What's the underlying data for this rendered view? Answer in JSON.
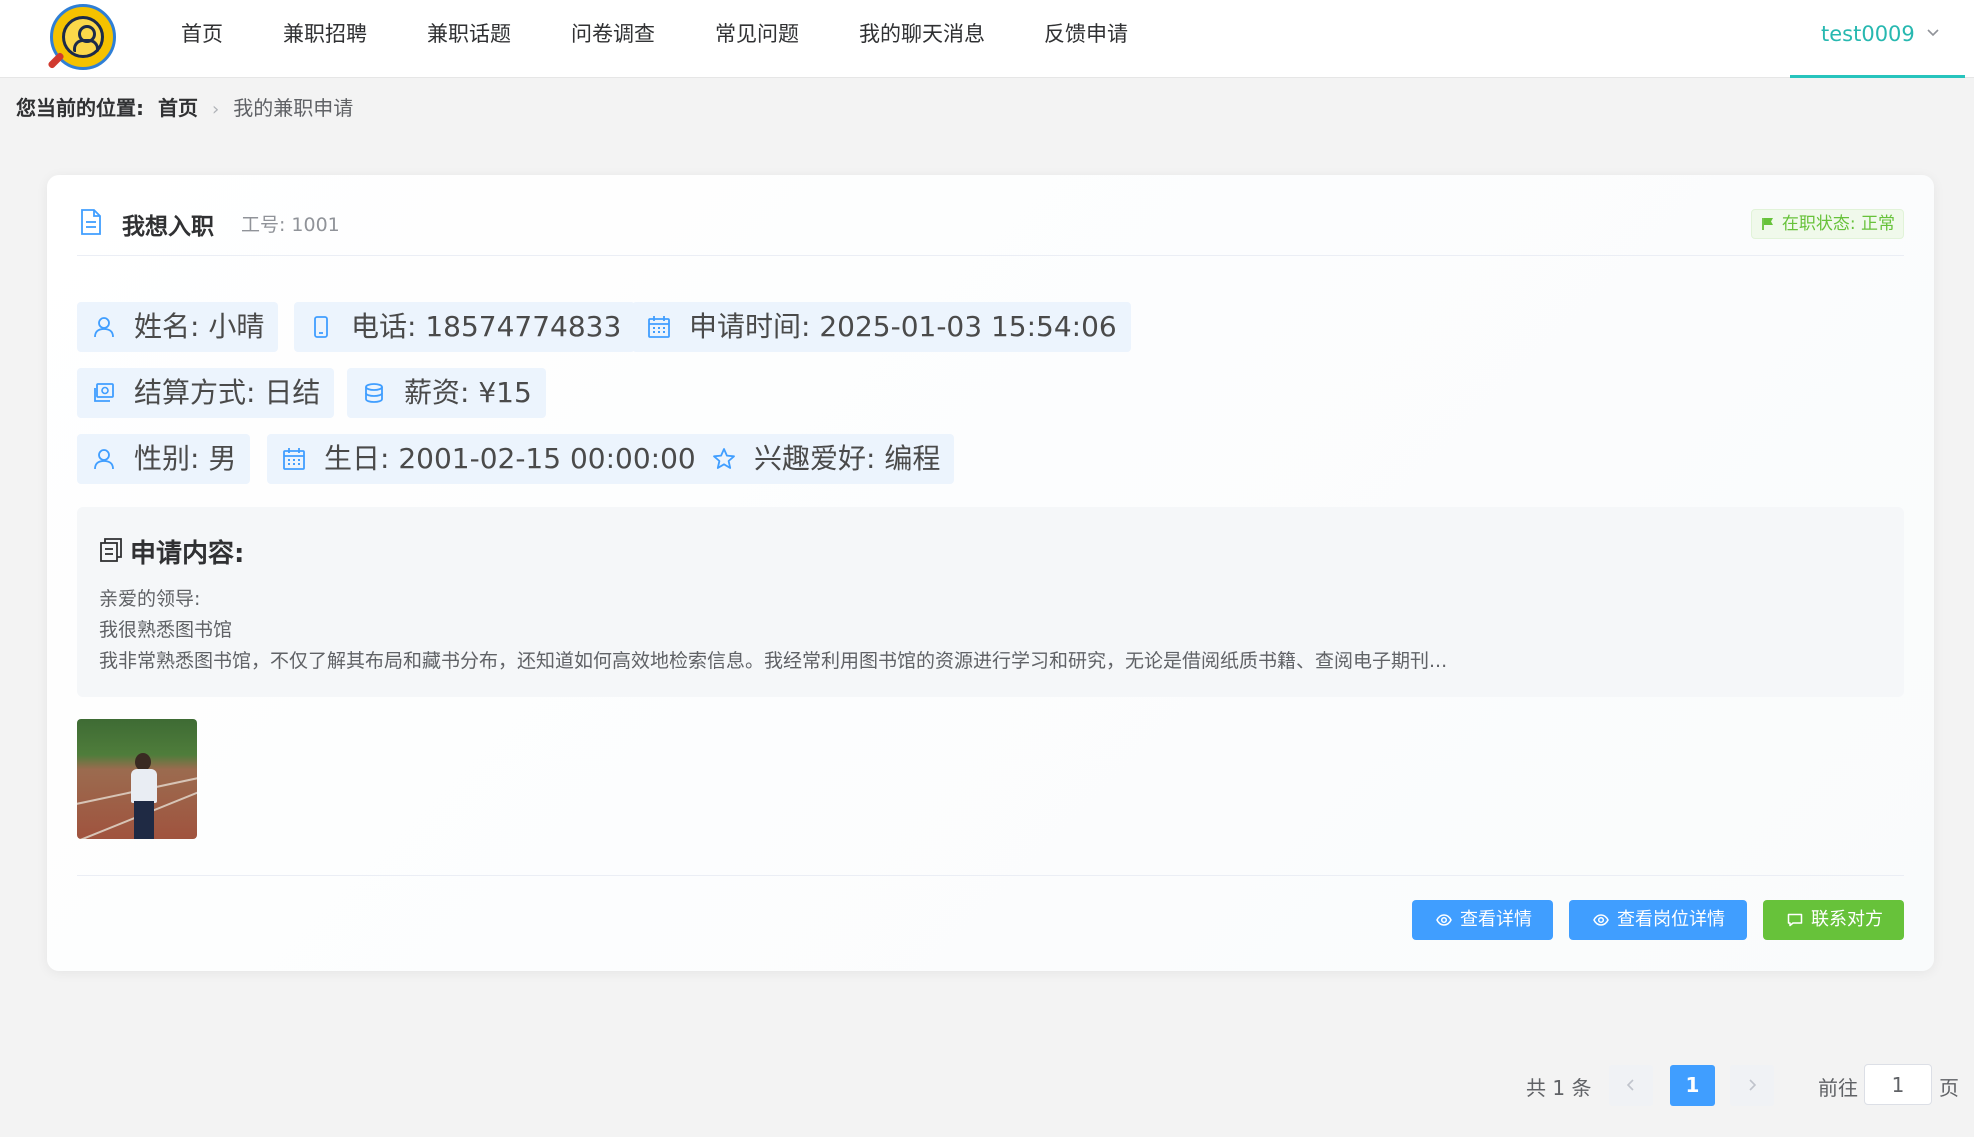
{
  "nav": {
    "items": [
      "首页",
      "兼职招聘",
      "兼职话题",
      "问卷调查",
      "常见问题",
      "我的聊天消息",
      "反馈申请"
    ],
    "user": "test0009"
  },
  "breadcrumb": {
    "label": "您当前的位置:",
    "home": "首页",
    "current": "我的兼职申请"
  },
  "card": {
    "title": "我想入职",
    "job_no_label": "工号:",
    "job_no": "1001",
    "status": "在职状态: 正常",
    "status_color": "#67c23a",
    "info": {
      "name": "姓名: 小晴",
      "phone": "电话: 18574774833",
      "apply_time": "申请时间: 2025-01-03 15:54:06",
      "settlement": "结算方式: 日结",
      "salary": "薪资: ¥15",
      "gender": "性别: 男",
      "birthday": "生日: 2001-02-15 00:00:00",
      "hobby": "兴趣爱好: 编程"
    },
    "content_title": "申请内容:",
    "content_lines": [
      "亲爱的领导:",
      "我很熟悉图书馆",
      "我非常熟悉图书馆，不仅了解其布局和藏书分布，还知道如何高效地检索信息。我经常利用图书馆的资源进行学习和研究，无论是借阅纸质书籍、查阅电子期刊..."
    ],
    "buttons": {
      "view_detail": "查看详情",
      "view_job": "查看岗位详情",
      "contact": "联系对方"
    },
    "accent": "#409eff"
  },
  "pagination": {
    "total": "共 1 条",
    "current_page": "1",
    "goto_label": "前往",
    "goto_value": "1",
    "suffix": "页"
  }
}
